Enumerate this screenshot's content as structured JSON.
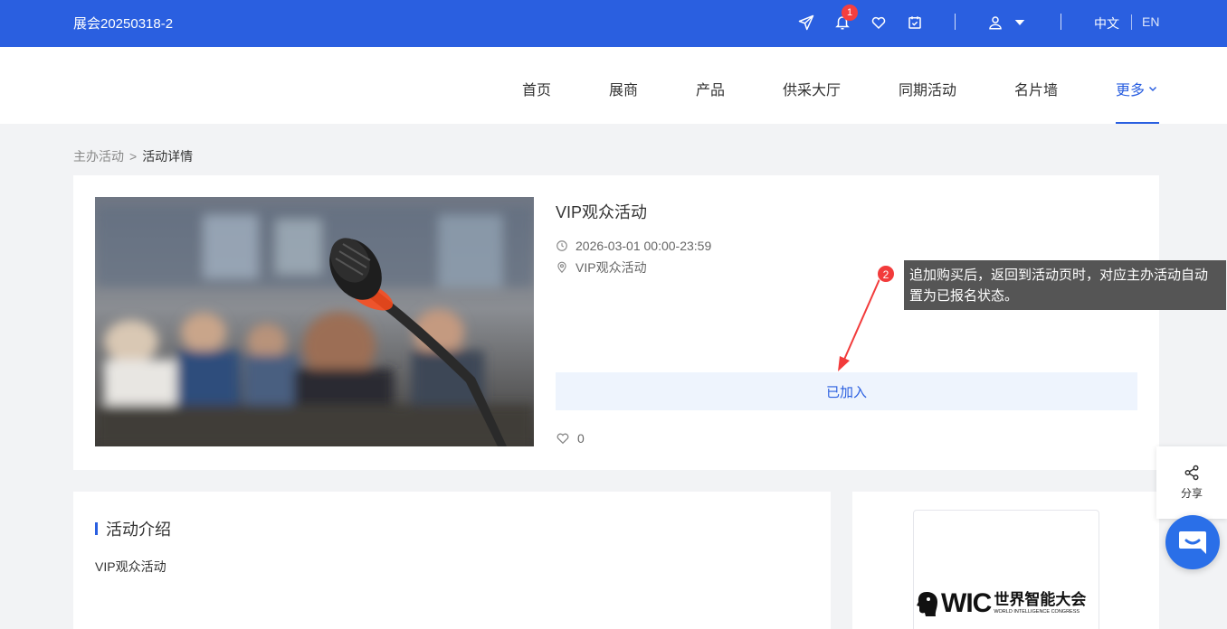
{
  "header": {
    "site_title": "展会20250318-2",
    "notification_count": "1",
    "icons": [
      "send-icon",
      "bell-icon",
      "heart-icon",
      "calendar-check-icon",
      "user-icon",
      "caret-down-icon"
    ],
    "languages": [
      "中文",
      "EN"
    ]
  },
  "nav": {
    "items": [
      "首页",
      "展商",
      "产品",
      "供采大厅",
      "同期活动",
      "名片墙",
      "更多"
    ],
    "active_index": 6
  },
  "breadcrumb": {
    "parent": "主办活动",
    "separator": ">",
    "current": "活动详情"
  },
  "event": {
    "title": "VIP观众活动",
    "time": "2026-03-01 00:00-23:59",
    "location": "VIP观众活动",
    "join_label": "已加入",
    "like_count": "0"
  },
  "annotation": {
    "number": "2",
    "text": "追加购买后，返回到活动页时，对应主办活动自动置为已报名状态。"
  },
  "intro": {
    "heading": "活动介绍",
    "text": "VIP观众活动"
  },
  "sponsor": {
    "logo_mark": "WIC",
    "logo_name": "世界智能大会",
    "logo_subtitle": "WORLD INTELLIGENCE CONGRESS"
  },
  "share": {
    "label": "分享"
  },
  "colors": {
    "primary": "#2a5fe0",
    "badge": "#f53f3f",
    "join_bg": "#eef4fd",
    "tooltip_bg": "#555555"
  }
}
